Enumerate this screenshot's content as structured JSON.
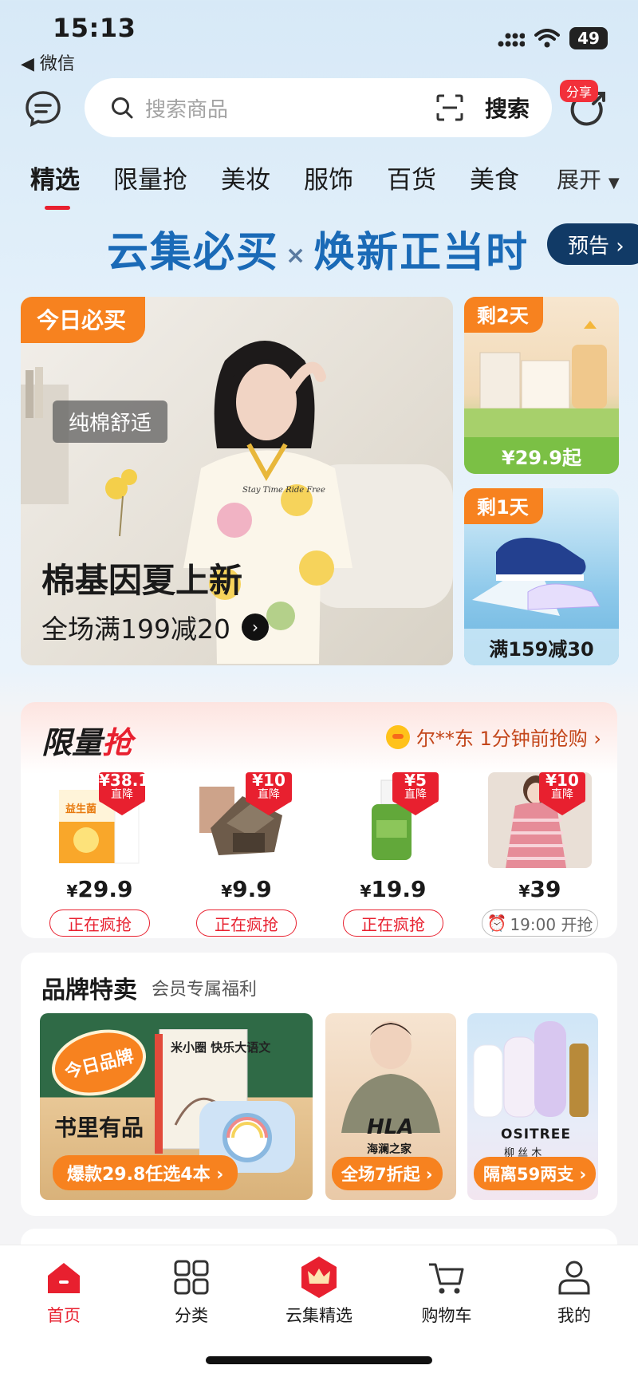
{
  "status_bar": {
    "time": "15:13",
    "back_app": "◀ 微信",
    "battery": "49"
  },
  "search": {
    "placeholder": "搜索商品",
    "button": "搜索"
  },
  "share_badge": "分享",
  "tabs": [
    "精选",
    "限量抢",
    "美妆",
    "服饰",
    "百货",
    "美食"
  ],
  "tabs_expand": "展开",
  "campaign": {
    "left": "云集必买",
    "x": "×",
    "right": "焕新正当时",
    "preview": "预告 ›"
  },
  "hero": {
    "tag": "今日必买",
    "pill": "纯棉舒适",
    "title": "棉基因夏上新",
    "sub": "全场满199减20",
    "shirt_text": "Stay Time Ride Free"
  },
  "side_cards": [
    {
      "tag": "剩2天",
      "price": "¥29.9起"
    },
    {
      "tag": "剩1天",
      "price": "满159减30"
    }
  ],
  "flash": {
    "title_a": "限量",
    "title_b": "抢",
    "notice": "尔**东 1分钟前抢购 ›",
    "products": [
      {
        "drop": "¥38.1",
        "drop_label": "直降",
        "price": "29.9",
        "status": "正在疯抢",
        "img_text": "益生菌"
      },
      {
        "drop": "¥10",
        "drop_label": "直降",
        "price": "9.9",
        "status": "正在疯抢"
      },
      {
        "drop": "¥5",
        "drop_label": "直降",
        "price": "19.9",
        "status": "正在疯抢"
      },
      {
        "drop": "¥10",
        "drop_label": "直降",
        "price": "39",
        "status": "19:00 开抢"
      }
    ],
    "currency": "¥"
  },
  "brand": {
    "title": "品牌特卖",
    "subtitle": "会员专属福利",
    "big": {
      "badge": "今日品牌",
      "name": "书里有品",
      "pill": "爆款29.8任选4本 ›",
      "book_title": "米小圈 快乐大语文"
    },
    "small": [
      {
        "logo": "HLA",
        "logo_sub": "海澜之家",
        "pill": "全场7折起 ›"
      },
      {
        "logo": "OSITREE",
        "logo_sub": "柳 丝 木",
        "pill": "隔离59两支 ›"
      }
    ]
  },
  "nav": [
    "首页",
    "分类",
    "云集精选",
    "购物车",
    "我的"
  ],
  "colors": {
    "accent": "#e8202f",
    "orange": "#f7821f",
    "campaign_blue": "#1a6ab7"
  }
}
